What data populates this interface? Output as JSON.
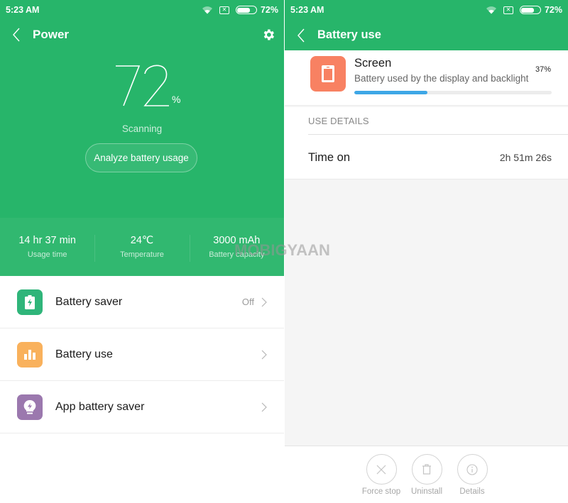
{
  "status_bar": {
    "time": "5:23 AM",
    "battery_percent": "72%",
    "battery_level": 0.72
  },
  "left": {
    "title": "Power",
    "battery_value": "72",
    "battery_unit": "%",
    "status": "Scanning",
    "analyze_button": "Analyze battery usage",
    "stats": [
      {
        "value": "14 hr 37 min",
        "label": "Usage time"
      },
      {
        "value": "24℃",
        "label": "Temperature"
      },
      {
        "value": "3000 mAh",
        "label": "Battery capacity"
      }
    ],
    "menu": [
      {
        "label": "Battery saver",
        "value": "Off",
        "icon": "battery-bolt-icon",
        "color": "#2fb57a"
      },
      {
        "label": "Battery use",
        "value": "",
        "icon": "bar-chart-icon",
        "color": "#f9b15c"
      },
      {
        "label": "App battery saver",
        "value": "",
        "icon": "bulb-bolt-icon",
        "color": "#9b78ae"
      }
    ]
  },
  "right": {
    "title": "Battery use",
    "item": {
      "title": "Screen",
      "description": "Battery used by the display and backlight",
      "percent_label": "37%",
      "percent": 0.37,
      "icon_color": "#f88162",
      "bar_color": "#3ea7e6"
    },
    "section_header": "USE DETAILS",
    "details": [
      {
        "key": "Time on",
        "value": "2h 51m 26s"
      }
    ],
    "actions": [
      {
        "label": "Force stop",
        "icon": "close-icon"
      },
      {
        "label": "Uninstall",
        "icon": "trash-icon"
      },
      {
        "label": "Details",
        "icon": "info-icon"
      }
    ]
  },
  "colors": {
    "primary_green": "#27b56a",
    "stats_green": "#31b870"
  },
  "watermark": "MOBIGYAAN"
}
